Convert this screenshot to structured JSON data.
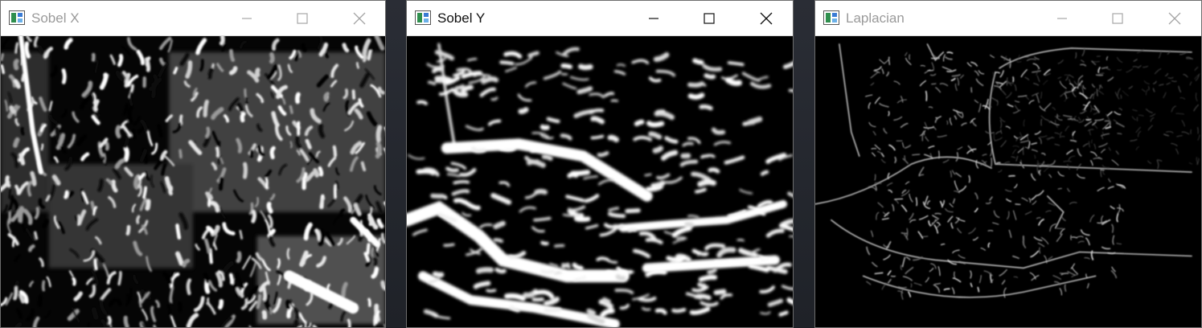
{
  "windows": [
    {
      "title": "Sobel X",
      "state": "inactive",
      "image_description_icon": "image-icon"
    },
    {
      "title": "Sobel Y",
      "state": "active",
      "image_description_icon": "image-icon"
    },
    {
      "title": "Laplacian",
      "state": "inactive",
      "image_description_icon": "image-icon"
    }
  ],
  "controls": {
    "minimize_icon": "minimize-icon",
    "maximize_icon": "maximize-icon",
    "close_icon": "close-icon"
  },
  "colors": {
    "titlebar": "#ffffff",
    "inactive_text": "#9a9a9a",
    "active_text": "#111111",
    "image_background": "#000000"
  }
}
